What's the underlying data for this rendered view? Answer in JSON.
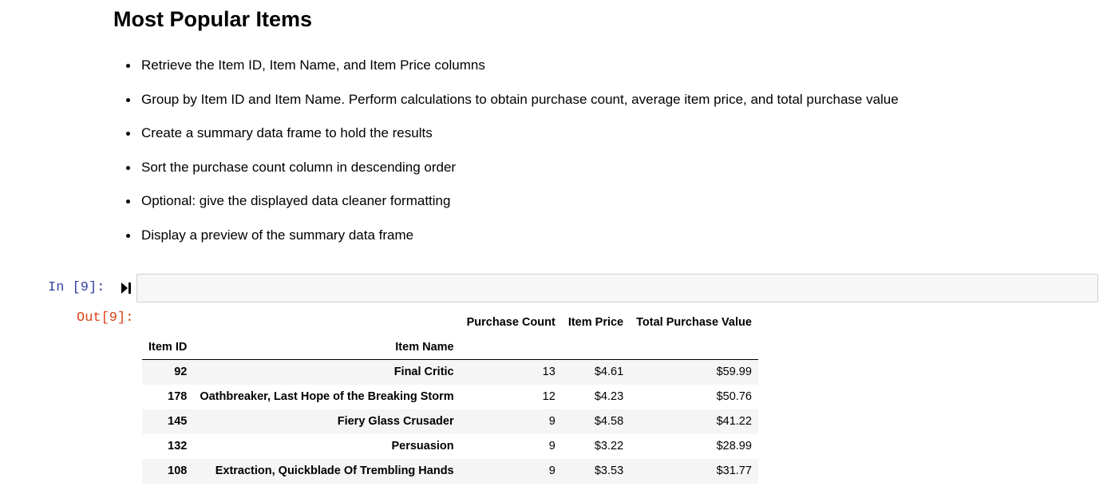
{
  "markdown": {
    "heading": "Most Popular Items",
    "bullets": [
      "Retrieve the Item ID, Item Name, and Item Price columns",
      "Group by Item ID and Item Name. Perform calculations to obtain purchase count, average item price, and total purchase value",
      "Create a summary data frame to hold the results",
      "Sort the purchase count column in descending order",
      "Optional: give the displayed data cleaner formatting",
      "Display a preview of the summary data frame"
    ]
  },
  "code_cell": {
    "in_prompt": "In [9]:",
    "out_prompt": "Out[9]:",
    "run_icon": "run-cell-icon",
    "code": ""
  },
  "table": {
    "columns": [
      "Purchase Count",
      "Item Price",
      "Total Purchase Value"
    ],
    "index_names": [
      "Item ID",
      "Item Name"
    ],
    "rows": [
      {
        "item_id": "92",
        "item_name": "Final Critic",
        "purchase_count": "13",
        "item_price": "$4.61",
        "total_value": "$59.99"
      },
      {
        "item_id": "178",
        "item_name": "Oathbreaker, Last Hope of the Breaking Storm",
        "purchase_count": "12",
        "item_price": "$4.23",
        "total_value": "$50.76"
      },
      {
        "item_id": "145",
        "item_name": "Fiery Glass Crusader",
        "purchase_count": "9",
        "item_price": "$4.58",
        "total_value": "$41.22"
      },
      {
        "item_id": "132",
        "item_name": "Persuasion",
        "purchase_count": "9",
        "item_price": "$3.22",
        "total_value": "$28.99"
      },
      {
        "item_id": "108",
        "item_name": "Extraction, Quickblade Of Trembling Hands",
        "purchase_count": "9",
        "item_price": "$3.53",
        "total_value": "$31.77"
      }
    ]
  },
  "colors": {
    "in_prompt": "#303f9f",
    "out_prompt": "#d84315",
    "input_background": "#f7f7f7",
    "input_border": "#cfcfcf",
    "row_stripe": "#f5f5f5"
  }
}
